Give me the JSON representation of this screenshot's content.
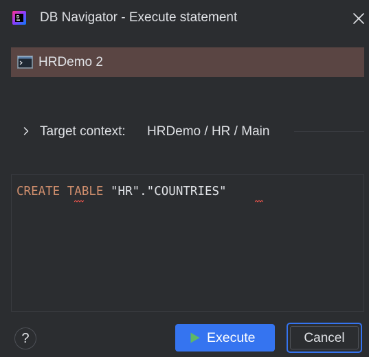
{
  "window": {
    "title": "DB Navigator - Execute statement",
    "app_icon": "dbn-plugin-icon",
    "close_icon": "close-icon"
  },
  "connection": {
    "name": "HRDemo 2",
    "icon": "console-icon",
    "highlight_color": "#5a4543"
  },
  "target_context": {
    "label": "Target context:",
    "value": "HRDemo / HR / Main",
    "expand_icon": "chevron-right-icon"
  },
  "editor": {
    "statement_tokens": [
      {
        "text": "CREATE",
        "kind": "keyword"
      },
      {
        "text": " ",
        "kind": "plain"
      },
      {
        "text": "TABLE",
        "kind": "keyword"
      },
      {
        "text": " ",
        "kind": "plain"
      },
      {
        "text": "\"HR\".\"COUNTRIES\"",
        "kind": "identifier"
      }
    ],
    "keyword_color": "#cf8e6d",
    "error_underline_color": "#e5534b"
  },
  "buttons": {
    "help_label": "?",
    "execute_label": "Execute",
    "execute_icon": "play-icon",
    "cancel_label": "Cancel"
  },
  "colors": {
    "background": "#2b2d30",
    "accent": "#3574f0",
    "play_green": "#5fb865"
  }
}
